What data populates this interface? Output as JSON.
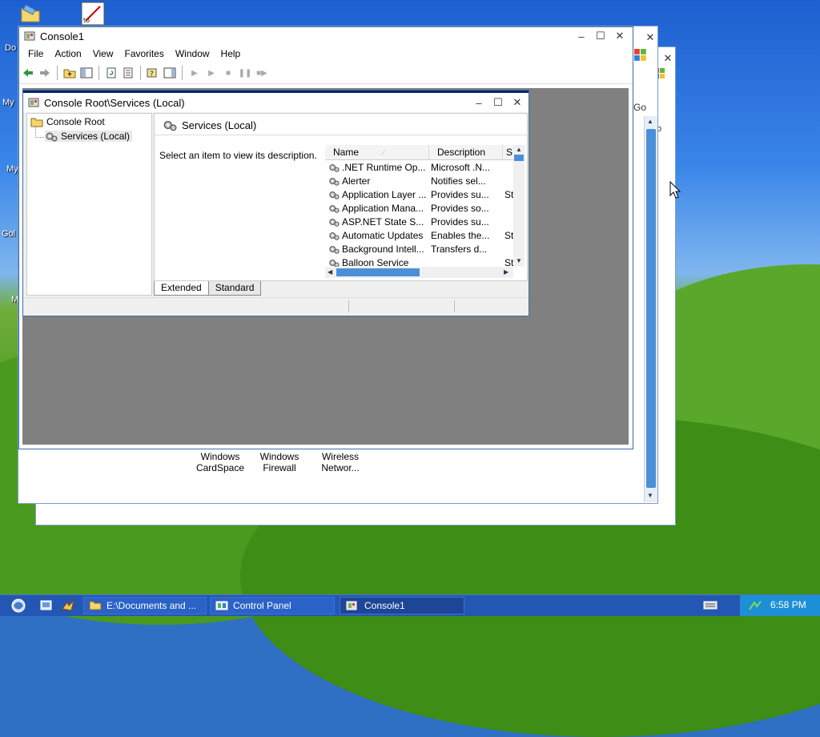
{
  "desktop": {
    "labels": [
      "Do",
      "My",
      "My",
      "Gol",
      "M"
    ]
  },
  "back_window": {
    "go_label": "Go",
    "go_label2": "o",
    "cp_items": [
      {
        "line1": "Windows",
        "line2": "CardSpace"
      },
      {
        "line1": "Windows",
        "line2": "Firewall"
      },
      {
        "line1": "Wireless",
        "line2": "Networ..."
      }
    ]
  },
  "console": {
    "title": "Console1",
    "menu": [
      "File",
      "Action",
      "View",
      "Favorites",
      "Window",
      "Help"
    ]
  },
  "child": {
    "title": "Console Root\\Services (Local)",
    "tree": {
      "root": "Console Root",
      "child": "Services (Local)"
    },
    "header": "Services (Local)",
    "description_prompt": "Select an item to view its description.",
    "columns": [
      "Name",
      "Description",
      "S"
    ],
    "rows": [
      {
        "name": ".NET Runtime Op...",
        "desc": "Microsoft .N...",
        "status": ""
      },
      {
        "name": "Alerter",
        "desc": "Notifies sel...",
        "status": ""
      },
      {
        "name": "Application Layer ...",
        "desc": "Provides su...",
        "status": "St"
      },
      {
        "name": "Application Mana...",
        "desc": "Provides so...",
        "status": ""
      },
      {
        "name": "ASP.NET State S...",
        "desc": "Provides su...",
        "status": ""
      },
      {
        "name": "Automatic Updates",
        "desc": "Enables the...",
        "status": "St"
      },
      {
        "name": "Background Intell...",
        "desc": "Transfers d...",
        "status": ""
      },
      {
        "name": "Balloon Service",
        "desc": "",
        "status": "St"
      }
    ],
    "tabs": [
      "Extended",
      "Standard"
    ]
  },
  "taskbar": {
    "tasks": [
      "E:\\Documents and ...",
      "Control Panel",
      "Console1"
    ],
    "clock": "6:58 PM"
  },
  "colors": {
    "taskbar": "#2456b4",
    "mdi_background": "#808080",
    "scroll_thumb": "#4a90d9"
  }
}
